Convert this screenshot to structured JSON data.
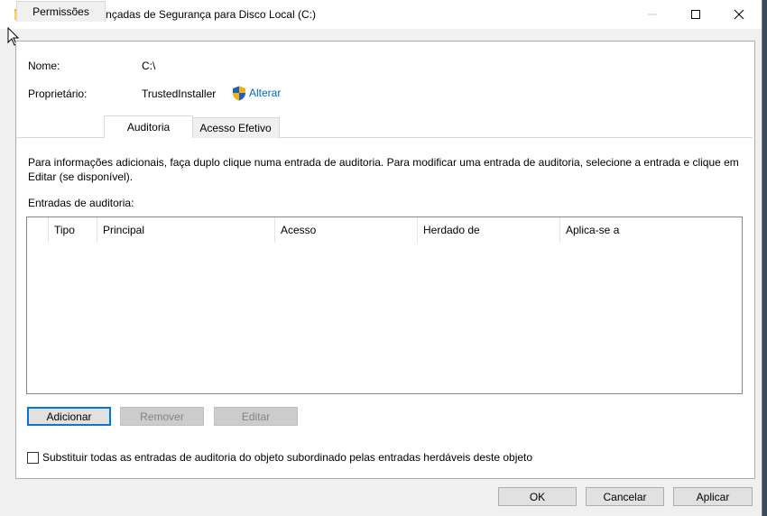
{
  "window": {
    "title": "Definições Avançadas de Segurança para Disco Local (C:)",
    "minimize_glyph": "—",
    "maximize_glyph": "☐",
    "close_glyph": "✕"
  },
  "fields": {
    "name_label": "Nome:",
    "name_value": "C:\\",
    "owner_label": "Proprietário:",
    "owner_value": "TrustedInstaller",
    "change_link": "Alterar"
  },
  "tabs": [
    {
      "label": "Permissões",
      "active": false
    },
    {
      "label": "Auditoria",
      "active": true
    },
    {
      "label": "Acesso Efetivo",
      "active": false
    }
  ],
  "audit": {
    "info_text": "Para informações adicionais, faça duplo clique numa entrada de auditoria. Para modificar uma entrada de auditoria, selecione a entrada e clique em Editar (se disponível).",
    "entries_label": "Entradas de auditoria:",
    "columns": [
      "Tipo",
      "Principal",
      "Acesso",
      "Herdado de",
      "Aplica-se a"
    ],
    "rows": []
  },
  "buttons": {
    "add": "Adicionar",
    "remove": "Remover",
    "edit": "Editar"
  },
  "checkbox": {
    "label": "Substituir todas as entradas de auditoria do objeto subordinado pelas entradas herdáveis deste objeto",
    "checked": false
  },
  "footer": {
    "ok": "OK",
    "cancel": "Cancelar",
    "apply": "Aplicar"
  },
  "icons": {
    "folder": "folder-icon",
    "shield": "uac-shield-icon"
  },
  "colors": {
    "link": "#0066cc",
    "default_button_border": "#0078d7"
  }
}
